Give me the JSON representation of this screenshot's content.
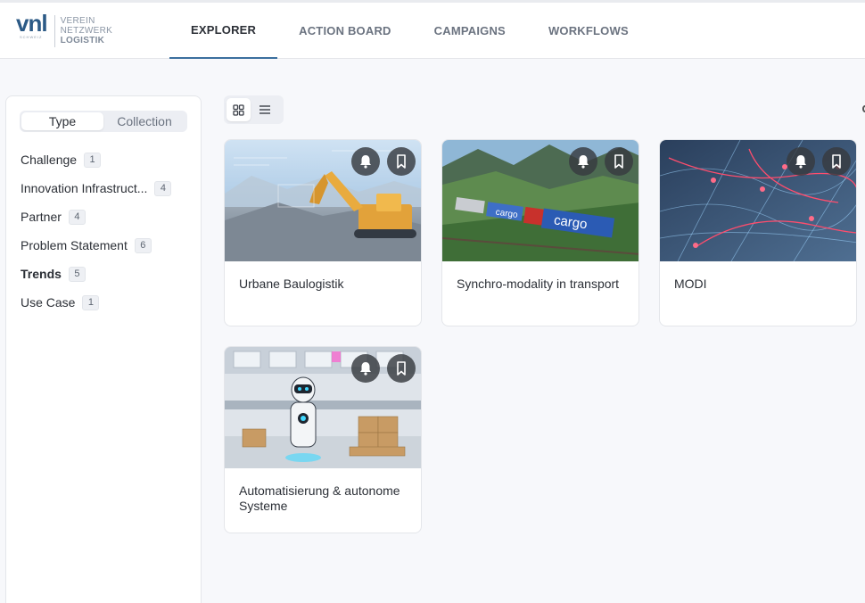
{
  "brand": {
    "mark": "vnl",
    "sub": "SCHWEIZ",
    "lines": [
      "VEREIN",
      "NETZWERK",
      "LOGISTIK"
    ]
  },
  "nav": {
    "tabs": [
      {
        "label": "EXPLORER",
        "active": true
      },
      {
        "label": "ACTION BOARD",
        "active": false
      },
      {
        "label": "CAMPAIGNS",
        "active": false
      },
      {
        "label": "WORKFLOWS",
        "active": false
      }
    ]
  },
  "sidebar": {
    "segments": [
      {
        "label": "Type",
        "active": true
      },
      {
        "label": "Collection",
        "active": false
      }
    ],
    "types": [
      {
        "label": "Challenge",
        "count": "1"
      },
      {
        "label": "Innovation Infrastruct...",
        "count": "4"
      },
      {
        "label": "Partner",
        "count": "4"
      },
      {
        "label": "Problem Statement",
        "count": "6"
      },
      {
        "label": "Trends",
        "count": "5",
        "selected": true
      },
      {
        "label": "Use Case",
        "count": "1"
      }
    ]
  },
  "view": {
    "grid_icon": "grid-icon",
    "list_icon": "list-icon",
    "active": "grid"
  },
  "cards": [
    {
      "title": "Urbane Baulogistik",
      "image": "excavator-construction-site"
    },
    {
      "title": "Synchro-modality in transport",
      "image": "cargo-train-mountains"
    },
    {
      "title": "MODI",
      "image": "digital-network-map"
    },
    {
      "title": "Automatisierung & autonome Systeme",
      "image": "robot-warehouse"
    }
  ],
  "icons": {
    "follow": "bell-icon",
    "save": "bookmark-icon"
  }
}
